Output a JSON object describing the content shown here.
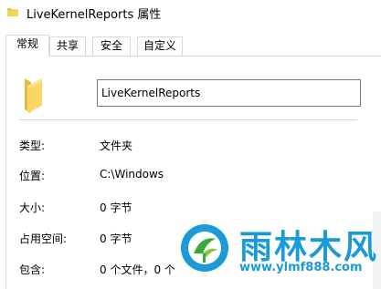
{
  "window": {
    "title": "LiveKernelReports 属性"
  },
  "tabs": [
    {
      "label": "常规",
      "active": true
    },
    {
      "label": "共享",
      "active": false
    },
    {
      "label": "安全",
      "active": false
    },
    {
      "label": "自定义",
      "active": false
    }
  ],
  "general": {
    "name_value": "LiveKernelReports",
    "rows": [
      {
        "label": "类型:",
        "value": "文件夹"
      },
      {
        "label": "位置:",
        "value": "C:\\Windows"
      },
      {
        "label": "大小:",
        "value": "0 字节"
      },
      {
        "label": "占用空间:",
        "value": "0 字节"
      },
      {
        "label": "包含:",
        "value": "0 个文件，0 个"
      }
    ]
  },
  "watermark": {
    "text_cn": "雨林木风",
    "url": "www.ylmf888.com"
  },
  "colors": {
    "folder": "#f5c84c",
    "watermark_blue": "#1a9ad6"
  },
  "icons": {
    "title": "folder-icon",
    "big": "folder-icon",
    "watermark": "ylmf-logo"
  }
}
